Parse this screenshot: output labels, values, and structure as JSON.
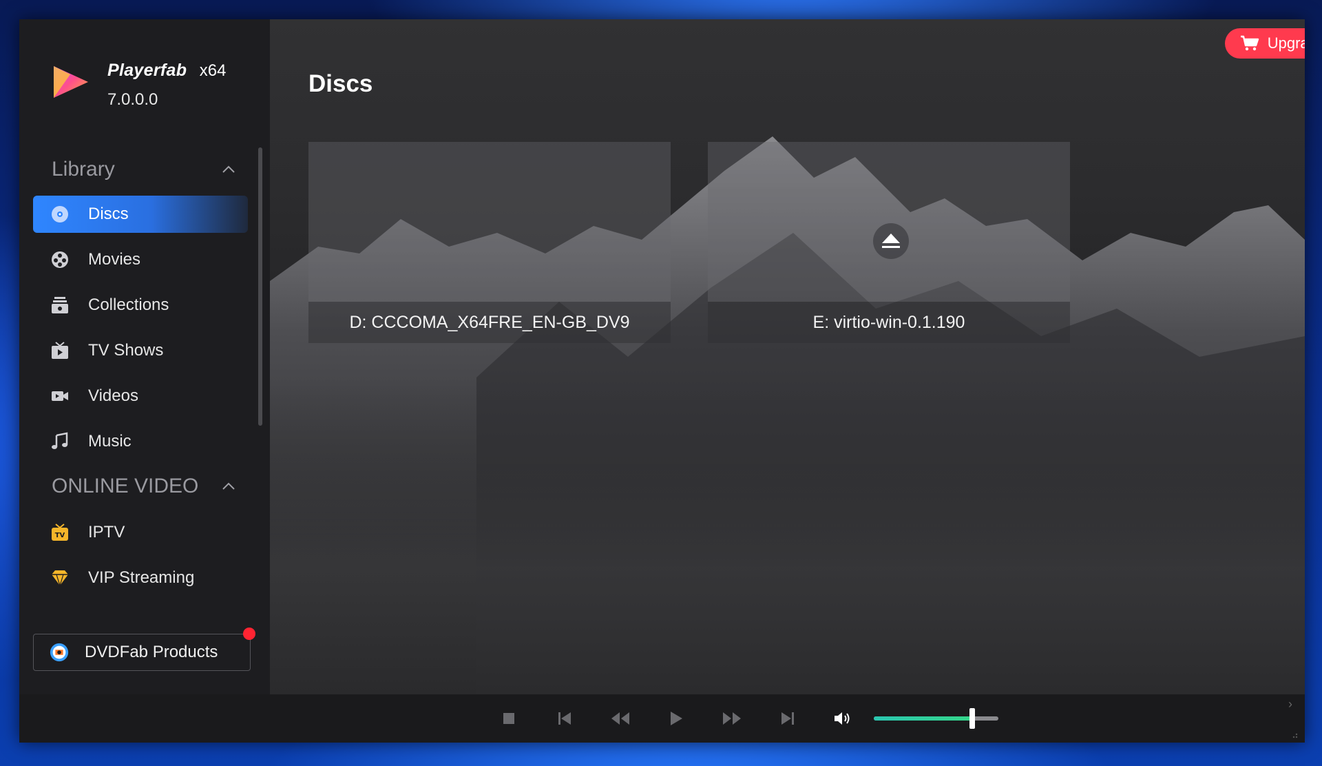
{
  "app": {
    "name": "Playerfab",
    "arch": "x64",
    "version": "7.0.0.0"
  },
  "sidebar": {
    "library_heading": "Library",
    "library_items": [
      {
        "label": "Discs",
        "icon": "disc-icon",
        "active": true
      },
      {
        "label": "Movies",
        "icon": "film-reel-icon"
      },
      {
        "label": "Collections",
        "icon": "collections-icon"
      },
      {
        "label": "TV Shows",
        "icon": "tv-icon"
      },
      {
        "label": "Videos",
        "icon": "video-camera-icon"
      },
      {
        "label": "Music",
        "icon": "music-note-icon"
      }
    ],
    "online_heading": "ONLINE VIDEO",
    "online_items": [
      {
        "label": "IPTV",
        "icon": "iptv-icon"
      },
      {
        "label": "VIP Streaming",
        "icon": "diamond-icon"
      }
    ],
    "products_label": "DVDFab Products"
  },
  "titlebar": {
    "upgrade_label": "Upgrade to Paid Version"
  },
  "main": {
    "title": "Discs",
    "discs": [
      {
        "label": "D: CCCOMA_X64FRE_EN-GB_DV9",
        "has_eject": false
      },
      {
        "label": "E: virtio-win-0.1.190",
        "has_eject": true
      }
    ]
  },
  "player": {
    "volume_fraction": 0.79
  },
  "colors": {
    "accent_blue": "#2f86ff",
    "upgrade_red": "#ff3a4e",
    "volume_green": "#35d68a",
    "notification_red": "#ff2432"
  }
}
